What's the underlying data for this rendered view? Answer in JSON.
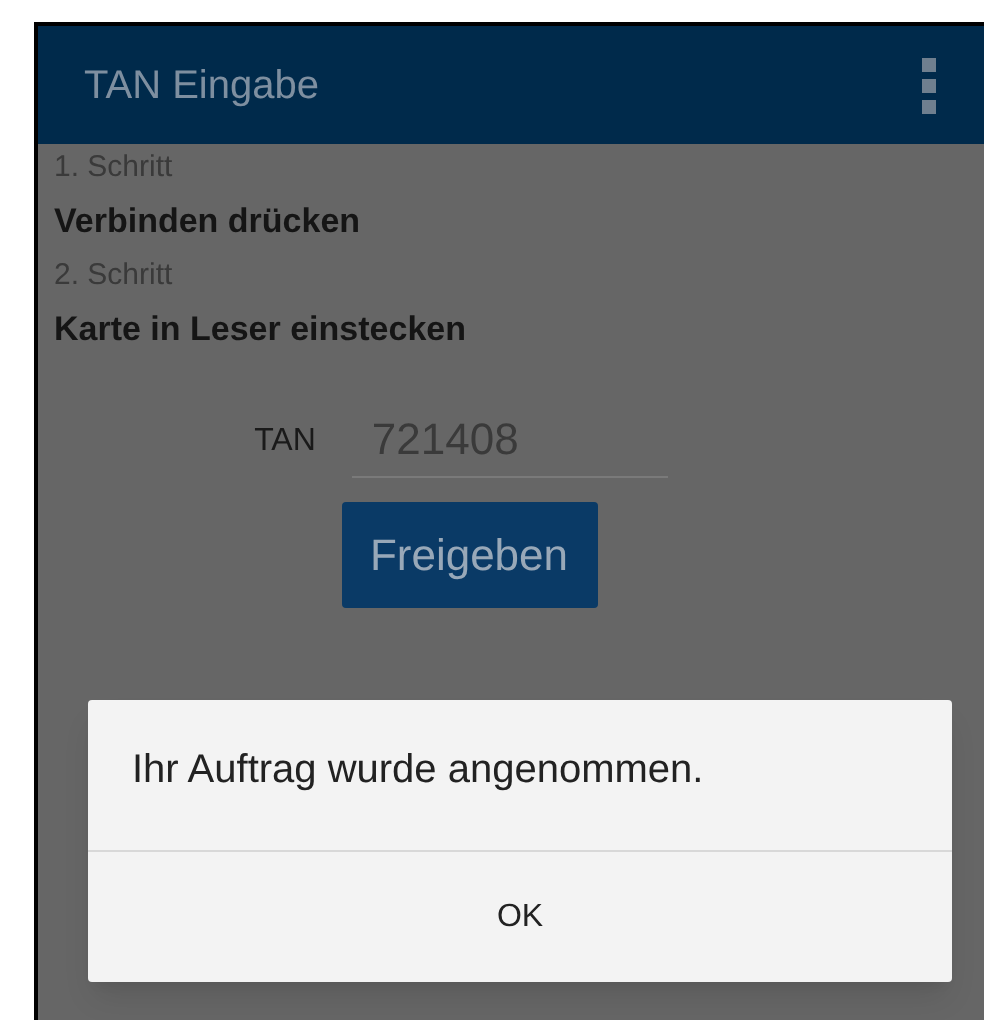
{
  "app_bar": {
    "title": "TAN Eingabe"
  },
  "steps": [
    {
      "label": "1. Schritt",
      "instruction": "Verbinden drücken"
    },
    {
      "label": "2. Schritt",
      "instruction": "Karte in Leser einstecken"
    }
  ],
  "tan_field": {
    "label": "TAN",
    "value": "721408"
  },
  "submit_button": "Freigeben",
  "dialog": {
    "message": "Ihr Auftrag wurde angenommen.",
    "button": "OK"
  }
}
